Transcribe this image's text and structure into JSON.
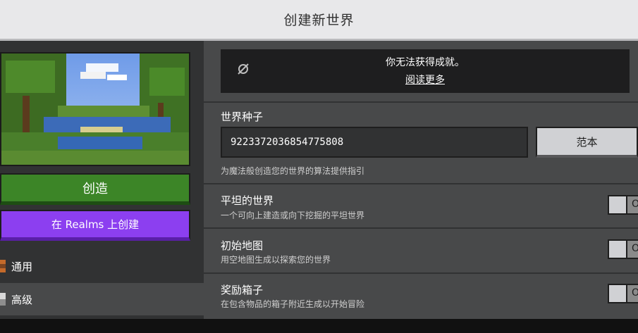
{
  "window": {
    "title": "创建新世界"
  },
  "left": {
    "create_button": "创造",
    "realms_button": "在 Realms 上创建",
    "nav": [
      {
        "label": "通用",
        "icon": "general-icon",
        "selected": false
      },
      {
        "label": "高级",
        "icon": "advanced-icon",
        "selected": true
      }
    ]
  },
  "notice": {
    "icon": "achievements-disabled-icon",
    "text": "你无法获得成就。",
    "link": "阅读更多"
  },
  "seed": {
    "label": "世界种子",
    "value": "9223372036854775808",
    "template_button": "范本",
    "description": "为魔法般创造您的世界的算法提供指引"
  },
  "settings": [
    {
      "label": "平坦的世界",
      "description": "一个可向上建造或向下挖掘的平坦世界",
      "state": "O"
    },
    {
      "label": "初始地图",
      "description": "用空地图生成以探索您的世界",
      "state": "O"
    },
    {
      "label": "奖励箱子",
      "description": "在包含物品的箱子附近生成以开始冒险",
      "state": "O"
    }
  ],
  "colors": {
    "create": "#3c8527",
    "realms": "#8c3ff0",
    "panel": "#48494a",
    "sidebar": "#313233"
  }
}
